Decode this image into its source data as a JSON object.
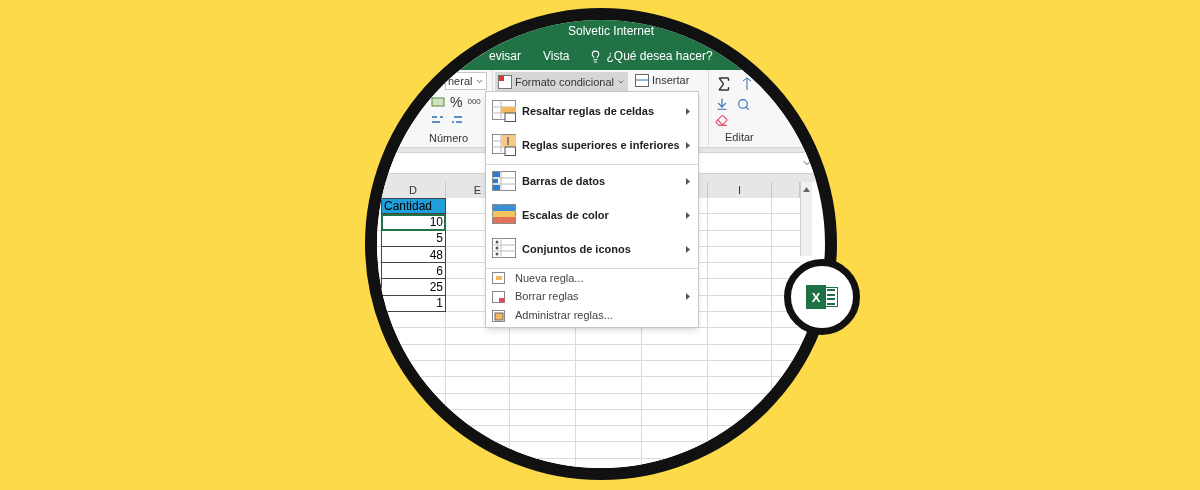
{
  "title_bar": {
    "title": "Solvetic Internet"
  },
  "ribbon_tabs": [
    {
      "label": "evisar",
      "selected": false
    },
    {
      "label": "Vista",
      "selected": false
    }
  ],
  "tell_me": {
    "placeholder": "¿Qué desea hacer?"
  },
  "ribbon": {
    "number_format": "neral",
    "percent": "%",
    "thousands": "000",
    "conditional_format": {
      "label": "Formato condicional",
      "open": true
    },
    "insert": "Insertar",
    "groups": [
      {
        "label": "Número"
      },
      {
        "label": "Editar"
      }
    ]
  },
  "columns": [
    {
      "label": "D"
    },
    {
      "label": "E"
    },
    {
      "label": "I"
    }
  ],
  "cells": [
    {
      "text": "Cantidad",
      "kind": "header",
      "selected": false
    },
    {
      "text": "10",
      "kind": "number",
      "selected": true
    },
    {
      "text": "5",
      "kind": "number",
      "selected": false
    },
    {
      "text": "48",
      "kind": "number",
      "selected": false
    },
    {
      "text": "6",
      "kind": "number",
      "selected": false
    },
    {
      "text": "25",
      "kind": "number",
      "selected": false
    },
    {
      "text": "1",
      "kind": "number",
      "selected": false
    }
  ],
  "menu": {
    "items": [
      {
        "label": "Resaltar reglas de celdas",
        "kind": "highlight",
        "submenu": true,
        "separator_before": false
      },
      {
        "label": "Reglas superiores e inferiores",
        "kind": "topbottom",
        "submenu": true,
        "separator_before": false
      },
      {
        "label": "Barras de datos",
        "kind": "databars",
        "submenu": true,
        "separator_before": true
      },
      {
        "label": "Escalas de color",
        "kind": "colorscale",
        "submenu": true,
        "separator_before": false
      },
      {
        "label": "Conjuntos de iconos",
        "kind": "iconsets",
        "submenu": true,
        "separator_before": false
      },
      {
        "label": "Nueva regla...",
        "kind": "new",
        "submenu": false,
        "separator_before": true
      },
      {
        "label": "Borrar reglas",
        "kind": "clear",
        "submenu": true,
        "separator_before": false
      },
      {
        "label": "Administrar reglas...",
        "kind": "manage",
        "submenu": false,
        "separator_before": false
      }
    ]
  },
  "badge": {
    "letter": "X"
  }
}
